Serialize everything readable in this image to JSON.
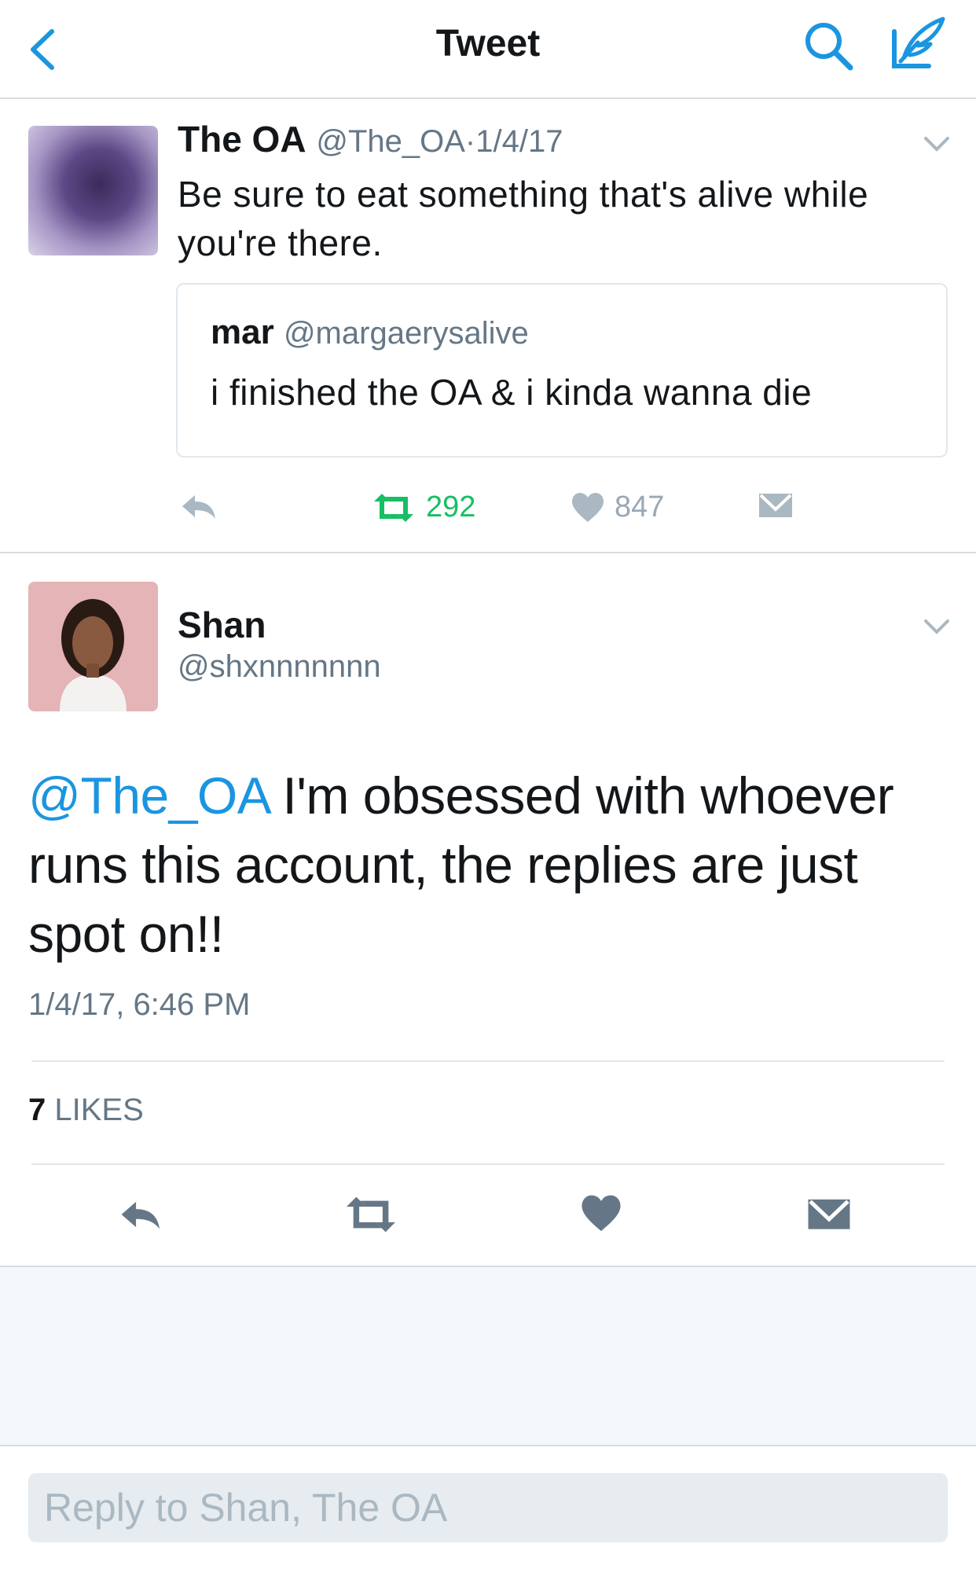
{
  "nav": {
    "title": "Tweet"
  },
  "quoted_tweet": {
    "author_name": "The OA",
    "author_handle": "@The_OA",
    "separator": "·",
    "date": "1/4/17",
    "text": "Be sure to eat something that's alive while you're there.",
    "quote": {
      "author_name": "mar",
      "author_handle": "@margaerysalive",
      "text": "i finished the OA & i kinda wanna die"
    },
    "retweet_count": "292",
    "like_count": "847"
  },
  "main_tweet": {
    "author_name": "Shan",
    "author_handle": "@shxnnnnnnn",
    "mention": "@The_OA",
    "text": " I'm obsessed with whoever runs this account, the replies are just spot on!!",
    "timestamp": "1/4/17, 6:46 PM",
    "likes_count": "7",
    "likes_label": "LIKES"
  },
  "reply": {
    "placeholder": "Reply to Shan, The OA"
  },
  "colors": {
    "accent": "#1b95e0",
    "retweet_green": "#17bf63",
    "secondary_text": "#657786",
    "icon_gray": "#657786"
  }
}
